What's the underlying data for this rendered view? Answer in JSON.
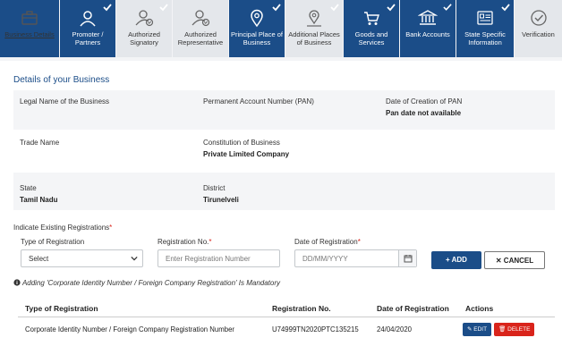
{
  "tabs": [
    {
      "label": "Business Details",
      "icon": "briefcase-icon",
      "state": "active",
      "checked": false
    },
    {
      "label": "Promoter / Partners",
      "icon": "person-icon",
      "state": "done",
      "checked": true
    },
    {
      "label": "Authorized Signatory",
      "icon": "person-check-icon",
      "state": "pending",
      "checked": true
    },
    {
      "label": "Authorized Representative",
      "icon": "person-check-icon",
      "state": "pending",
      "checked": false
    },
    {
      "label": "Principal Place of Business",
      "icon": "map-pin-icon",
      "state": "done",
      "checked": true
    },
    {
      "label": "Additional Places of Business",
      "icon": "map-pins-icon",
      "state": "pending",
      "checked": true
    },
    {
      "label": "Goods and Services",
      "icon": "cart-icon",
      "state": "done",
      "checked": true
    },
    {
      "label": "Bank Accounts",
      "icon": "bank-icon",
      "state": "done",
      "checked": true
    },
    {
      "label": "State Specific Information",
      "icon": "id-card-icon",
      "state": "done",
      "checked": true
    },
    {
      "label": "Verification",
      "icon": "check-circle-icon",
      "state": "pending",
      "checked": false
    }
  ],
  "section_title": "Details of your Business",
  "fields": {
    "legal_name_label": "Legal Name of the Business",
    "legal_name_value": "",
    "pan_label": "Permanent Account Number (PAN)",
    "pan_value": "",
    "pan_date_label": "Date of Creation of PAN",
    "pan_date_value": "Pan date not available",
    "trade_name_label": "Trade Name",
    "trade_name_value": "",
    "constitution_label": "Constitution of Business",
    "constitution_value": "Private Limited Company",
    "state_label": "State",
    "state_value": "Tamil Nadu",
    "district_label": "District",
    "district_value": "Tirunelveli"
  },
  "registrations": {
    "heading": "Indicate Existing Registrations",
    "type_label": "Type of Registration",
    "type_value": "Select",
    "number_label": "Registration No.",
    "number_placeholder": "Enter Registration Number",
    "date_label": "Date of Registration",
    "date_placeholder": "DD/MM/YYYY",
    "add_label": "ADD",
    "cancel_label": "CANCEL",
    "note": "Adding 'Corporate Identity Number / Foreign Company Registration' Is Mandatory",
    "table": {
      "headers": [
        "Type of Registration",
        "Registration No.",
        "Date of Registration",
        "Actions"
      ],
      "rows": [
        {
          "type": "Corporate Identity Number / Foreign Company Registration Number",
          "number": "U74999TN2020PTC135215",
          "date": "24/04/2020",
          "edit_label": "EDIT",
          "delete_label": "DELETE"
        }
      ]
    }
  },
  "colors": {
    "primary": "#1b4d88",
    "danger": "#d9241b",
    "required": "#d9241b"
  }
}
